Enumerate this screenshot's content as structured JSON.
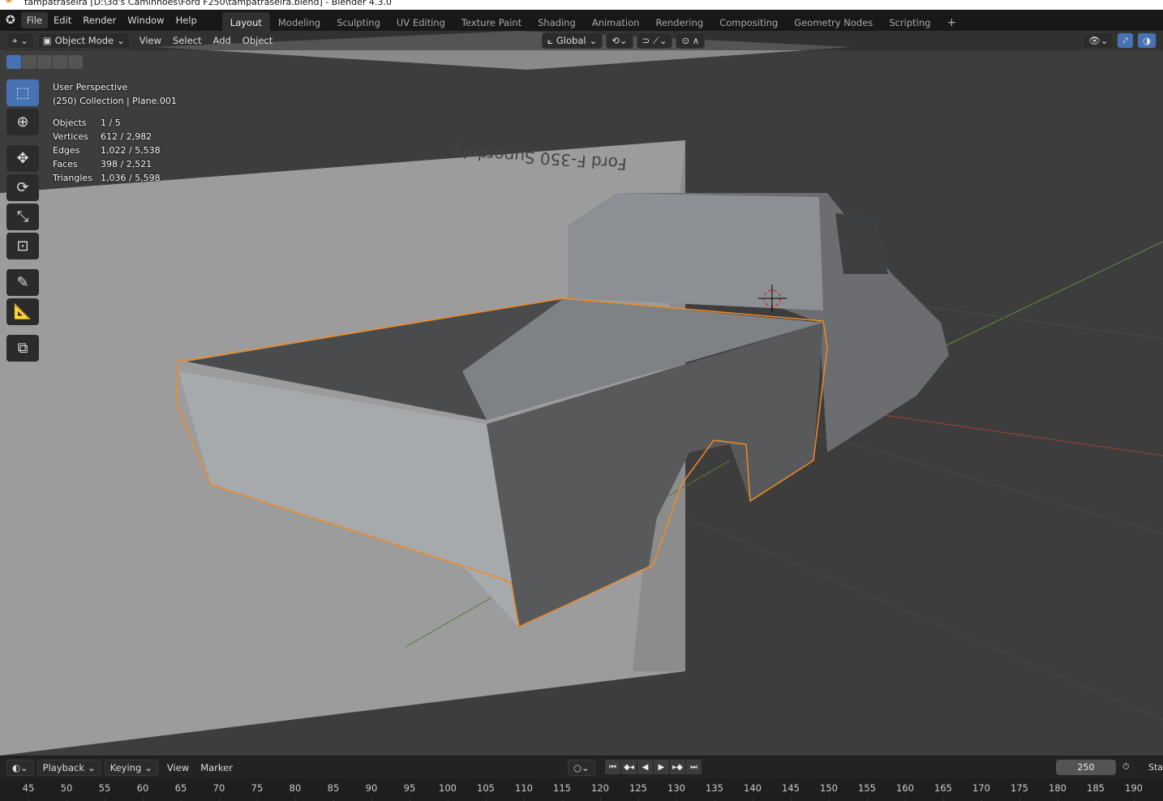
{
  "window": {
    "title": "tampatraseira [D:\\3d's Caminhoes\\Ford F250\\tampatraseira.blend] - Blender 4.3.0"
  },
  "menus": [
    "File",
    "Edit",
    "Render",
    "Window",
    "Help"
  ],
  "workspaces": [
    "Layout",
    "Modeling",
    "Sculpting",
    "UV Editing",
    "Texture Paint",
    "Shading",
    "Animation",
    "Rendering",
    "Compositing",
    "Geometry Nodes",
    "Scripting",
    "+"
  ],
  "header": {
    "mode": "Object Mode",
    "menus": [
      "View",
      "Select",
      "Add",
      "Object"
    ],
    "orientation": "Global"
  },
  "overlay": {
    "view": "User Perspective",
    "context": "(250) Collection | Plane.001",
    "stats": [
      {
        "k": "Objects",
        "v": "1 / 5"
      },
      {
        "k": "Vertices",
        "v": "612 / 2,982"
      },
      {
        "k": "Edges",
        "v": "1,022 / 5,538"
      },
      {
        "k": "Faces",
        "v": "398 / 2,521"
      },
      {
        "k": "Triangles",
        "v": "1,036 / 5,598"
      }
    ]
  },
  "reference_text": "Ford F-350 Superduty",
  "timeline": {
    "menus": [
      "Playback",
      "Keying",
      "View",
      "Marker"
    ],
    "current_frame": "250",
    "start_label": "Sta",
    "ticks": [
      "45",
      "50",
      "55",
      "60",
      "65",
      "70",
      "75",
      "80",
      "85",
      "90",
      "95",
      "100",
      "105",
      "110",
      "115",
      "120",
      "125",
      "130",
      "135",
      "140",
      "145",
      "150",
      "155",
      "160",
      "165",
      "170",
      "175",
      "180",
      "185",
      "190"
    ]
  },
  "colors": {
    "accent": "#4772b3",
    "selection": "#f08a24",
    "viewport": "#3d3d3d"
  }
}
